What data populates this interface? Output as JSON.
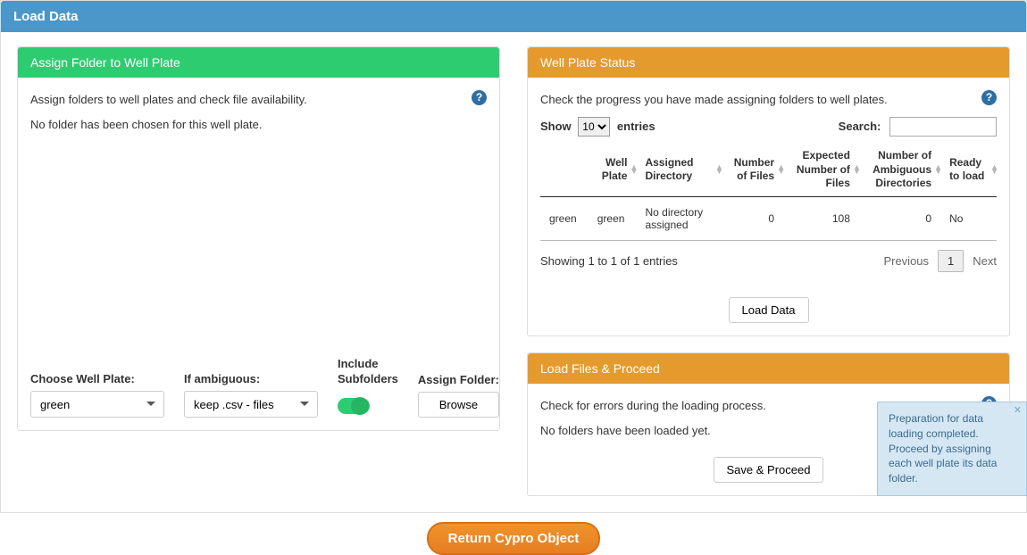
{
  "outer": {
    "title": "Load Data"
  },
  "assign": {
    "title": "Assign Folder to Well Plate",
    "desc": "Assign folders to well plates and check file availability.",
    "status": "No folder has been chosen for this well plate.",
    "labels": {
      "choose": "Choose Well Plate:",
      "ambiguous": "If ambiguous:",
      "subfolders": "Include Subfolders",
      "assign": "Assign Folder:"
    },
    "values": {
      "choose": "green",
      "ambiguous": "keep .csv - files"
    },
    "browse_btn": "Browse"
  },
  "status_panel": {
    "title": "Well Plate Status",
    "desc": "Check the progress you have made assigning folders to well plates.",
    "show": "Show",
    "entries": "entries",
    "entries_n": "10",
    "search": "Search:",
    "columns": [
      "",
      "Well Plate",
      "Assigned Directory",
      "Number of Files",
      "Expected Number of Files",
      "Number of Ambiguous Directories",
      "Ready to load"
    ],
    "row": {
      "c0": "green",
      "c1": "green",
      "c2": "No directory assigned",
      "c3": "0",
      "c4": "108",
      "c5": "0",
      "c6": "No"
    },
    "info": "Showing 1 to 1 of 1 entries",
    "prev": "Previous",
    "page": "1",
    "next": "Next",
    "load_btn": "Load Data"
  },
  "proceed": {
    "title": "Load Files & Proceed",
    "desc": "Check for errors during the loading process.",
    "status": "No folders have been loaded yet.",
    "save_btn": "Save & Proceed"
  },
  "footer_btn": "Return Cypro Object",
  "toast": "Preparation for data loading completed. Proceed by assigning each well plate its data folder."
}
